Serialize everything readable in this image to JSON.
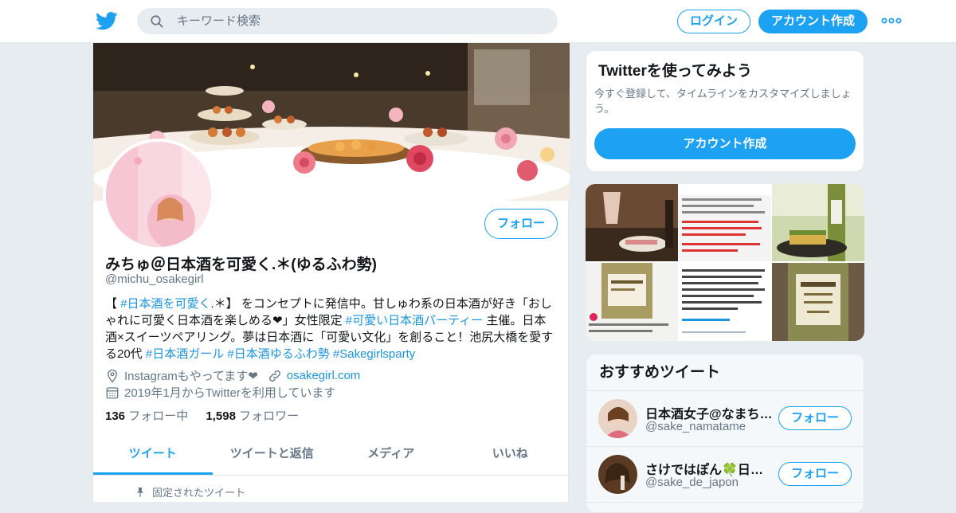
{
  "header": {
    "search_placeholder": "キーワード検索",
    "login_label": "ログイン",
    "signup_label": "アカウント作成",
    "brand_color": "#1da1f2"
  },
  "profile": {
    "name": "みちゅ＠日本酒を可愛く.＊(ゆるふわ勢)",
    "handle": "@michu_osakegirl",
    "follow_label": "フォロー",
    "bio": {
      "p1": "【 ",
      "l1": "#日本酒を可愛く",
      "p2": ".＊】 をコンセプトに発信中。甘しゅわ系の日本酒が好き「おしゃれに可愛く日本酒を楽しめる❤」女性限定 ",
      "l2": "#可愛い日本酒パーティー",
      "p3": " 主催。日本酒×スイーツペアリング。夢は日本酒に「可愛い文化」を創ること！池尻大橋を愛する20代 ",
      "l3": "#日本酒ガール",
      "l4": "#日本酒ゆるふわ勢",
      "l5": "#Sakegirlsparty"
    },
    "location": "Instagramもやってます❤",
    "website": "osakegirl.com",
    "joined": "2019年1月からTwitterを利用しています",
    "following_count": "136",
    "following_label": "フォロー中",
    "followers_count": "1,598",
    "followers_label": "フォロワー",
    "tabs": [
      "ツイート",
      "ツイートと返信",
      "メディア",
      "いいね"
    ],
    "pinned_label": "固定されたツイート"
  },
  "try_twitter": {
    "title": "Twitterを使ってみよう",
    "description": "今すぐ登録して、タイムラインをカスタマイズしましょう。",
    "button_label": "アカウント作成"
  },
  "recommended": {
    "title": "おすすめツイート",
    "users": [
      {
        "name": "日本酒女子@なまちゃん",
        "handle": "@sake_namatame",
        "follow_label": "フォロー"
      },
      {
        "name": "さけではぽん🍀日本酒専門",
        "handle": "@sake_de_japon",
        "follow_label": "フォロー"
      }
    ]
  }
}
